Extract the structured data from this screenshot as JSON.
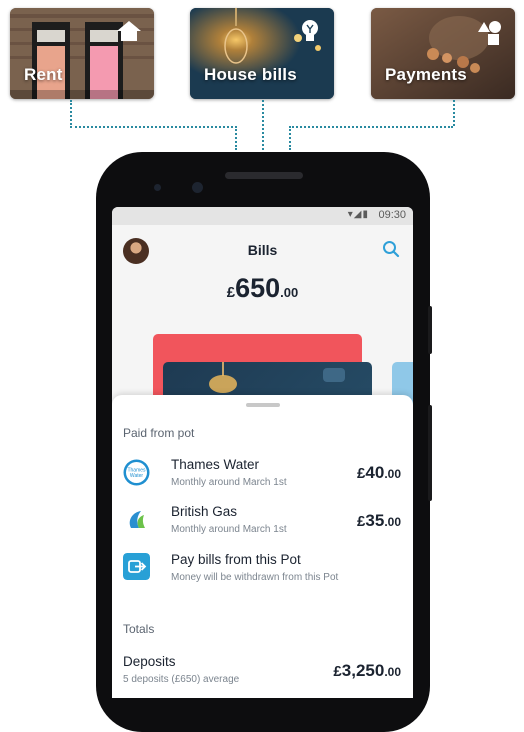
{
  "cards": [
    {
      "label": "Rent",
      "icon": "house-icon"
    },
    {
      "label": "House bills",
      "icon": "lightbulb-icon"
    },
    {
      "label": "Payments",
      "icon": "shapes-icon"
    }
  ],
  "status": {
    "time": "09:30",
    "icons": "▾◢▮"
  },
  "pot": {
    "title": "Bills",
    "balance": {
      "currency": "£",
      "major": "650",
      "minor": ".00"
    }
  },
  "sheet": {
    "section_paid": "Paid from pot",
    "rows": [
      {
        "title": "Thames Water",
        "subtitle": "Monthly around March 1st",
        "currency": "£",
        "major": "40",
        "minor": ".00",
        "logo_text": "Thames Water"
      },
      {
        "title": "British Gas",
        "subtitle": "Monthly around March 1st",
        "currency": "£",
        "major": "35",
        "minor": ".00"
      }
    ],
    "pay_bills": {
      "title": "Pay bills from this Pot",
      "subtitle": "Money will be withdrawn from this Pot"
    },
    "section_totals": "Totals",
    "deposits": {
      "title": "Deposits",
      "subtitle": "5 deposits (£650) average",
      "currency": "£",
      "major": "3,250",
      "minor": ".00"
    }
  },
  "colors": {
    "accent": "#2fa0d8",
    "connector": "#2a8aa0",
    "pot_red": "#f1555c",
    "pay_tile": "#28a0d6"
  }
}
